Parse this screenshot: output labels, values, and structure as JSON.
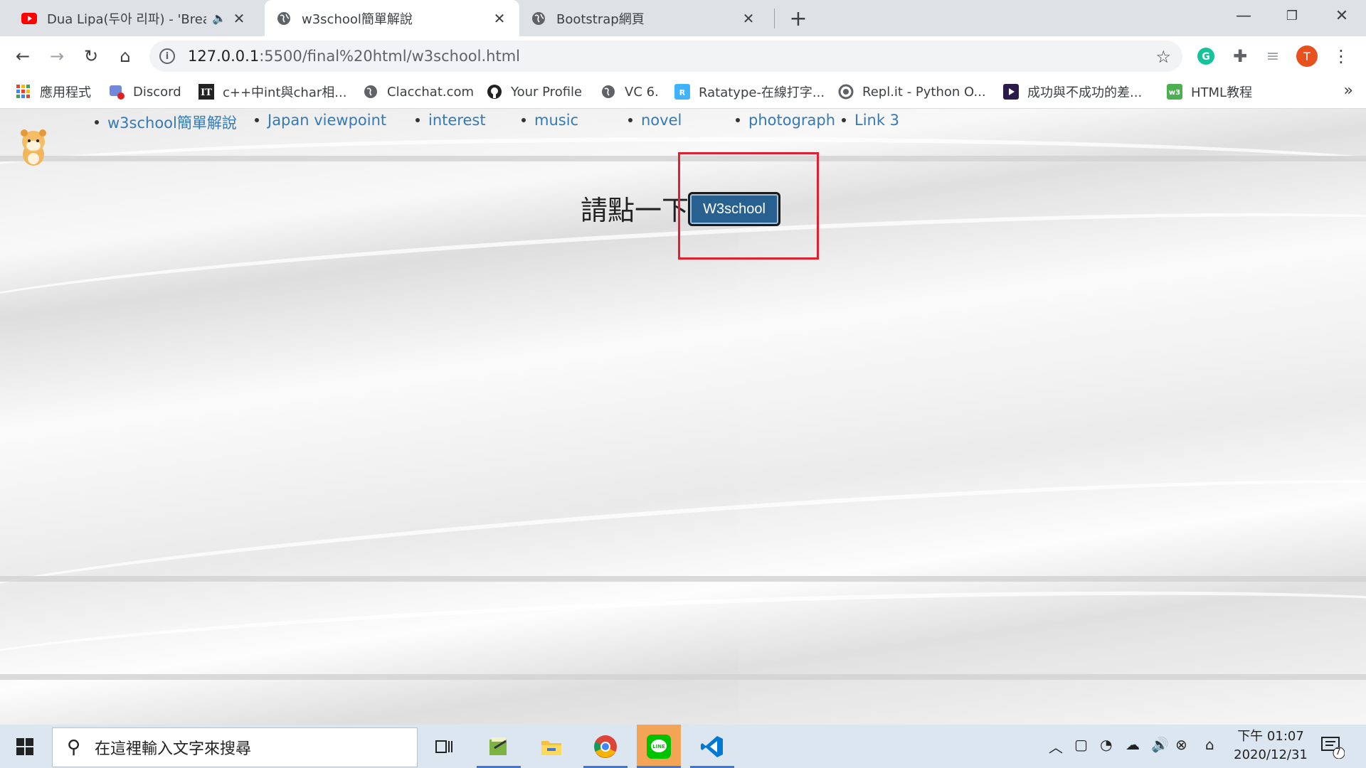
{
  "browser": {
    "tabs": [
      {
        "title": "Dua Lipa(두아 리파) - 'Break",
        "icon": "youtube-icon",
        "audio": true,
        "active": false
      },
      {
        "title": "w3school簡單解說",
        "icon": "globe-icon",
        "audio": false,
        "active": true
      },
      {
        "title": "Bootstrap網頁",
        "icon": "globe-icon",
        "audio": false,
        "active": false
      }
    ],
    "url_host": "127.0.0.1",
    "url_rest": ":5500/final%20html/w3school.html",
    "profile_initial": "T",
    "bookmarks": [
      {
        "label": "應用程式",
        "icon": "apps-grid-icon"
      },
      {
        "label": "Discord",
        "icon": "discord-icon"
      },
      {
        "label": "c++中int與char相...",
        "icon": "it-icon"
      },
      {
        "label": "Clacchat.com",
        "icon": "globe-icon"
      },
      {
        "label": "Your Profile",
        "icon": "github-icon"
      },
      {
        "label": "VC 6.",
        "icon": "globe-icon"
      },
      {
        "label": "Ratatype-在線打字...",
        "icon": "ratatype-icon"
      },
      {
        "label": "Repl.it - Python O...",
        "icon": "replit-icon"
      },
      {
        "label": "成功與不成功的差...",
        "icon": "play-icon"
      },
      {
        "label": "HTML教程",
        "icon": "w3-icon"
      }
    ]
  },
  "page": {
    "nav": [
      "w3school簡單解說",
      "Japan viewpoint",
      "interest",
      "music",
      "novel",
      "photograph",
      "Link 3"
    ],
    "cta_text": "請點一下",
    "cta_button": "W3school",
    "colors": {
      "link": "#337ab7",
      "button": "#286090",
      "highlight": "#e0202e"
    }
  },
  "taskbar": {
    "search_placeholder": "在這裡輸入文字來搜尋",
    "time": "下午 01:07",
    "date": "2020/12/31",
    "notification_count": "7"
  }
}
